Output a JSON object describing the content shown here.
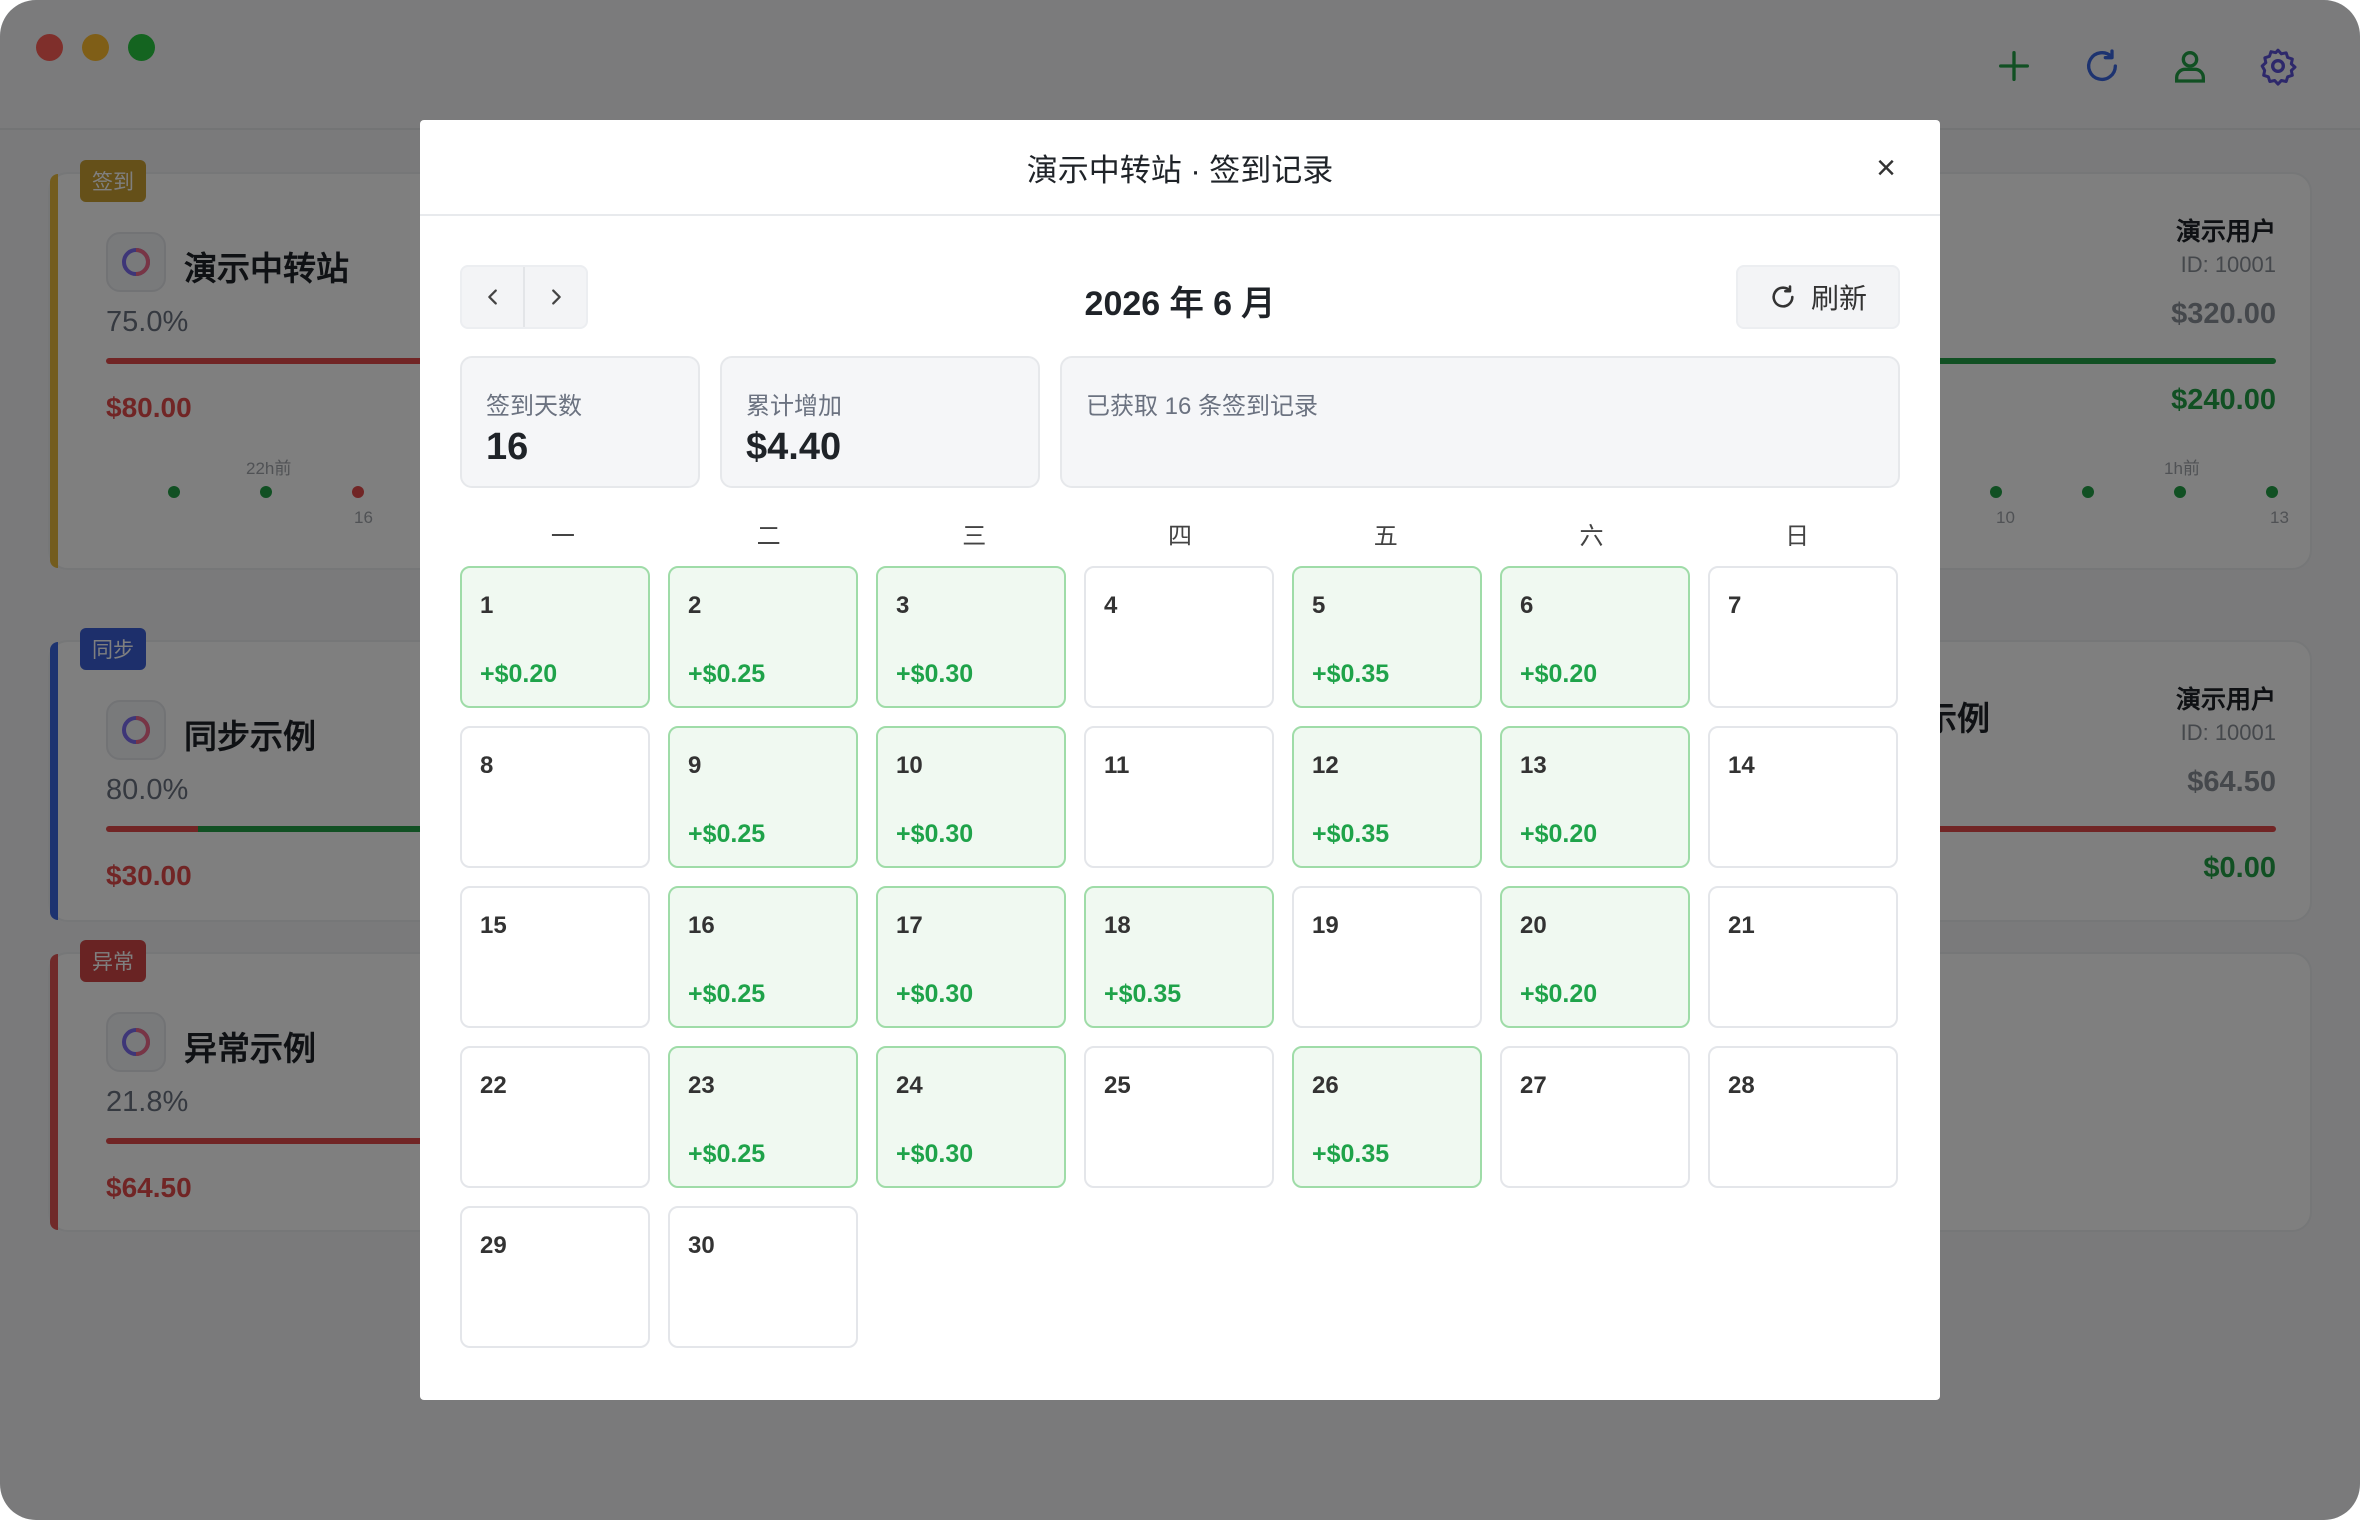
{
  "toolbar": {
    "add_icon": "plus-icon",
    "refresh_icon": "refresh-icon",
    "user_icon": "user-icon",
    "settings_icon": "gear-icon"
  },
  "cards": [
    {
      "tag": "签到",
      "tag_color": "#caa033",
      "accent": "#e6b93c",
      "name": "演示中转站",
      "percent": "75.0%",
      "amount": "$80.00",
      "amount_color": "#e24b4b",
      "bar_color": "#e24b4b",
      "timeline_label": "22h前",
      "timeline_tick": "16",
      "right_user": "演示用户",
      "right_id": "ID: 10001",
      "right_total": "$320.00",
      "right_remaining": "$240.00",
      "right_remaining_color": "#22a046",
      "right_bar_color": "#22a046",
      "right_timeline_label": "1h前",
      "right_tick_a": "10",
      "right_tick_b": "13"
    },
    {
      "tag": "同步",
      "tag_color": "#3b5fd6",
      "accent": "#3b66e0",
      "name": "同步示例",
      "percent": "80.0%",
      "amount": "$30.00",
      "amount_color": "#e24b4b",
      "bar_color": "#22a046",
      "right_name_partial": "示例",
      "right_user": "演示用户",
      "right_id": "ID: 10001",
      "right_total": "$64.50",
      "right_remaining": "$0.00",
      "right_remaining_color": "#22a046",
      "right_bar_color": "#e24b4b"
    },
    {
      "tag": "异常",
      "tag_color": "#d24646",
      "accent": "#e05555",
      "name": "异常示例",
      "percent": "21.8%",
      "amount": "$64.50",
      "amount_color": "#e24b4b",
      "bar_color": "#e24b4b"
    }
  ],
  "modal": {
    "title": "演示中转站 · 签到记录",
    "close": "×",
    "month": "2026 年 6 月",
    "refresh_label": "刷新",
    "stats": {
      "days_label": "签到天数",
      "days_value": "16",
      "total_label": "累计增加",
      "total_value": "$4.40",
      "info": "已获取 16 条签到记录"
    },
    "weekdays": [
      "一",
      "二",
      "三",
      "四",
      "五",
      "六",
      "日"
    ],
    "days": [
      {
        "day": "1",
        "reward": "+$0.20"
      },
      {
        "day": "2",
        "reward": "+$0.25"
      },
      {
        "day": "3",
        "reward": "+$0.30"
      },
      {
        "day": "4",
        "reward": ""
      },
      {
        "day": "5",
        "reward": "+$0.35"
      },
      {
        "day": "6",
        "reward": "+$0.20"
      },
      {
        "day": "7",
        "reward": ""
      },
      {
        "day": "8",
        "reward": ""
      },
      {
        "day": "9",
        "reward": "+$0.25"
      },
      {
        "day": "10",
        "reward": "+$0.30"
      },
      {
        "day": "11",
        "reward": ""
      },
      {
        "day": "12",
        "reward": "+$0.35"
      },
      {
        "day": "13",
        "reward": "+$0.20"
      },
      {
        "day": "14",
        "reward": ""
      },
      {
        "day": "15",
        "reward": ""
      },
      {
        "day": "16",
        "reward": "+$0.25"
      },
      {
        "day": "17",
        "reward": "+$0.30"
      },
      {
        "day": "18",
        "reward": "+$0.35"
      },
      {
        "day": "19",
        "reward": ""
      },
      {
        "day": "20",
        "reward": "+$0.20"
      },
      {
        "day": "21",
        "reward": ""
      },
      {
        "day": "22",
        "reward": ""
      },
      {
        "day": "23",
        "reward": "+$0.25"
      },
      {
        "day": "24",
        "reward": "+$0.30"
      },
      {
        "day": "25",
        "reward": ""
      },
      {
        "day": "26",
        "reward": "+$0.35"
      },
      {
        "day": "27",
        "reward": ""
      },
      {
        "day": "28",
        "reward": ""
      },
      {
        "day": "29",
        "reward": ""
      },
      {
        "day": "30",
        "reward": ""
      }
    ]
  }
}
